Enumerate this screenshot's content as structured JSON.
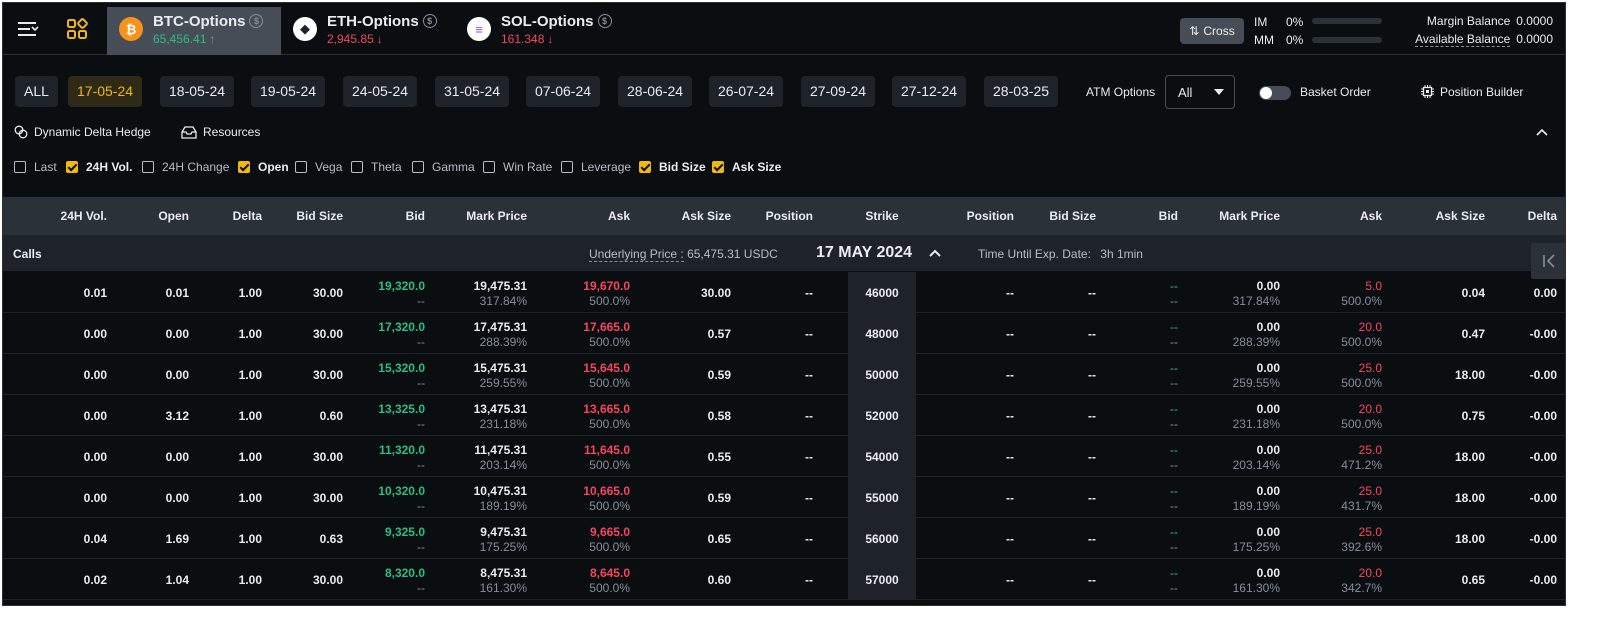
{
  "header": {
    "assets": [
      {
        "name": "BTC-Options",
        "price": "65,456.41",
        "arrow": "↑",
        "direction": "up",
        "coin_color": "#f7931a",
        "coin_glyph": "₿"
      },
      {
        "name": "ETH-Options",
        "price": "2,945.85",
        "arrow": "↓",
        "direction": "down",
        "coin_color": "#ffffff",
        "coin_glyph": "◆"
      },
      {
        "name": "SOL-Options",
        "price": "161.348",
        "arrow": "↓",
        "direction": "down",
        "coin_color": "#ffffff",
        "coin_glyph": "≡"
      }
    ],
    "info_glyph": "$",
    "cross_label": "Cross",
    "im_label": "IM",
    "im_value": "0%",
    "mm_label": "MM",
    "mm_value": "0%",
    "margin_balance_label": "Margin Balance",
    "margin_balance_value": "0.0000",
    "available_balance_label": "Available Balance",
    "available_balance_value": "0.0000"
  },
  "dates": [
    "ALL",
    "17-05-24",
    "18-05-24",
    "19-05-24",
    "24-05-24",
    "31-05-24",
    "07-06-24",
    "28-06-24",
    "26-07-24",
    "27-09-24",
    "27-12-24",
    "28-03-25"
  ],
  "active_date_index": 1,
  "atm": {
    "label": "ATM Options",
    "value": "All"
  },
  "basket_label": "Basket Order",
  "position_builder_label": "Position Builder",
  "tools": {
    "dynamic_delta_hedge": "Dynamic Delta Hedge",
    "resources": "Resources"
  },
  "column_toggles": [
    {
      "label": "Last",
      "checked": false
    },
    {
      "label": "24H Vol.",
      "checked": true
    },
    {
      "label": "24H Change",
      "checked": false
    },
    {
      "label": "Open",
      "checked": true
    },
    {
      "label": "Vega",
      "checked": false
    },
    {
      "label": "Theta",
      "checked": false
    },
    {
      "label": "Gamma",
      "checked": false
    },
    {
      "label": "Win Rate",
      "checked": false
    },
    {
      "label": "Leverage",
      "checked": false
    },
    {
      "label": "Bid Size",
      "checked": true
    },
    {
      "label": "Ask Size",
      "checked": true
    }
  ],
  "table": {
    "call_headers": [
      "24H Vol.",
      "Open",
      "Delta",
      "Bid Size",
      "Bid",
      "Mark Price",
      "Ask",
      "Ask Size",
      "Position"
    ],
    "strike_header": "Strike",
    "put_headers": [
      "Position",
      "Bid Size",
      "Bid",
      "Mark Price",
      "Ask",
      "Ask Size",
      "Delta"
    ],
    "calls_label": "Calls",
    "underlying_label": "Underlying Price :",
    "underlying_value": "65,475.31 USDC",
    "expiry_date": "17 MAY 2024",
    "time_until_label": "Time Until Exp. Date:",
    "time_until_value": "3h 1min",
    "rows": [
      {
        "c_vol": "0.01",
        "c_open": "0.01",
        "c_delta": "1.00",
        "c_bidsize": "30.00",
        "c_bid": "19,320.0",
        "c_bid_iv": "--",
        "c_mark": "19,475.31",
        "c_mark_iv": "317.84%",
        "c_ask": "19,670.0",
        "c_ask_iv": "500.0%",
        "c_asksize": "30.00",
        "c_pos": "--",
        "strike": "46000",
        "p_pos": "--",
        "p_bidsize": "--",
        "p_bid": "--",
        "p_bid_iv": "--",
        "p_mark": "0.00",
        "p_mark_iv": "317.84%",
        "p_ask": "5.0",
        "p_ask_iv": "500.0%",
        "p_asksize": "0.04",
        "p_delta": "0.00"
      },
      {
        "c_vol": "0.00",
        "c_open": "0.00",
        "c_delta": "1.00",
        "c_bidsize": "30.00",
        "c_bid": "17,320.0",
        "c_bid_iv": "--",
        "c_mark": "17,475.31",
        "c_mark_iv": "288.39%",
        "c_ask": "17,665.0",
        "c_ask_iv": "500.0%",
        "c_asksize": "0.57",
        "c_pos": "--",
        "strike": "48000",
        "p_pos": "--",
        "p_bidsize": "--",
        "p_bid": "--",
        "p_bid_iv": "--",
        "p_mark": "0.00",
        "p_mark_iv": "288.39%",
        "p_ask": "20.0",
        "p_ask_iv": "500.0%",
        "p_asksize": "0.47",
        "p_delta": "-0.00"
      },
      {
        "c_vol": "0.00",
        "c_open": "0.00",
        "c_delta": "1.00",
        "c_bidsize": "30.00",
        "c_bid": "15,320.0",
        "c_bid_iv": "--",
        "c_mark": "15,475.31",
        "c_mark_iv": "259.55%",
        "c_ask": "15,645.0",
        "c_ask_iv": "500.0%",
        "c_asksize": "0.59",
        "c_pos": "--",
        "strike": "50000",
        "p_pos": "--",
        "p_bidsize": "--",
        "p_bid": "--",
        "p_bid_iv": "--",
        "p_mark": "0.00",
        "p_mark_iv": "259.55%",
        "p_ask": "25.0",
        "p_ask_iv": "500.0%",
        "p_asksize": "18.00",
        "p_delta": "-0.00"
      },
      {
        "c_vol": "0.00",
        "c_open": "3.12",
        "c_delta": "1.00",
        "c_bidsize": "0.60",
        "c_bid": "13,325.0",
        "c_bid_iv": "--",
        "c_mark": "13,475.31",
        "c_mark_iv": "231.18%",
        "c_ask": "13,665.0",
        "c_ask_iv": "500.0%",
        "c_asksize": "0.58",
        "c_pos": "--",
        "strike": "52000",
        "p_pos": "--",
        "p_bidsize": "--",
        "p_bid": "--",
        "p_bid_iv": "--",
        "p_mark": "0.00",
        "p_mark_iv": "231.18%",
        "p_ask": "20.0",
        "p_ask_iv": "500.0%",
        "p_asksize": "0.75",
        "p_delta": "-0.00"
      },
      {
        "c_vol": "0.00",
        "c_open": "0.00",
        "c_delta": "1.00",
        "c_bidsize": "30.00",
        "c_bid": "11,320.0",
        "c_bid_iv": "--",
        "c_mark": "11,475.31",
        "c_mark_iv": "203.14%",
        "c_ask": "11,645.0",
        "c_ask_iv": "500.0%",
        "c_asksize": "0.55",
        "c_pos": "--",
        "strike": "54000",
        "p_pos": "--",
        "p_bidsize": "--",
        "p_bid": "--",
        "p_bid_iv": "--",
        "p_mark": "0.00",
        "p_mark_iv": "203.14%",
        "p_ask": "25.0",
        "p_ask_iv": "471.2%",
        "p_asksize": "18.00",
        "p_delta": "-0.00"
      },
      {
        "c_vol": "0.00",
        "c_open": "0.00",
        "c_delta": "1.00",
        "c_bidsize": "30.00",
        "c_bid": "10,320.0",
        "c_bid_iv": "--",
        "c_mark": "10,475.31",
        "c_mark_iv": "189.19%",
        "c_ask": "10,665.0",
        "c_ask_iv": "500.0%",
        "c_asksize": "0.59",
        "c_pos": "--",
        "strike": "55000",
        "p_pos": "--",
        "p_bidsize": "--",
        "p_bid": "--",
        "p_bid_iv": "--",
        "p_mark": "0.00",
        "p_mark_iv": "189.19%",
        "p_ask": "25.0",
        "p_ask_iv": "431.7%",
        "p_asksize": "18.00",
        "p_delta": "-0.00"
      },
      {
        "c_vol": "0.04",
        "c_open": "1.69",
        "c_delta": "1.00",
        "c_bidsize": "0.63",
        "c_bid": "9,325.0",
        "c_bid_iv": "--",
        "c_mark": "9,475.31",
        "c_mark_iv": "175.25%",
        "c_ask": "9,665.0",
        "c_ask_iv": "500.0%",
        "c_asksize": "0.65",
        "c_pos": "--",
        "strike": "56000",
        "p_pos": "--",
        "p_bidsize": "--",
        "p_bid": "--",
        "p_bid_iv": "--",
        "p_mark": "0.00",
        "p_mark_iv": "175.25%",
        "p_ask": "25.0",
        "p_ask_iv": "392.6%",
        "p_asksize": "18.00",
        "p_delta": "-0.00"
      },
      {
        "c_vol": "0.02",
        "c_open": "1.04",
        "c_delta": "1.00",
        "c_bidsize": "30.00",
        "c_bid": "8,320.0",
        "c_bid_iv": "--",
        "c_mark": "8,475.31",
        "c_mark_iv": "161.30%",
        "c_ask": "8,645.0",
        "c_ask_iv": "500.0%",
        "c_asksize": "0.60",
        "c_pos": "--",
        "strike": "57000",
        "p_pos": "--",
        "p_bidsize": "--",
        "p_bid": "--",
        "p_bid_iv": "--",
        "p_mark": "0.00",
        "p_mark_iv": "161.30%",
        "p_ask": "20.0",
        "p_ask_iv": "342.7%",
        "p_asksize": "0.65",
        "p_delta": "-0.00"
      }
    ]
  }
}
